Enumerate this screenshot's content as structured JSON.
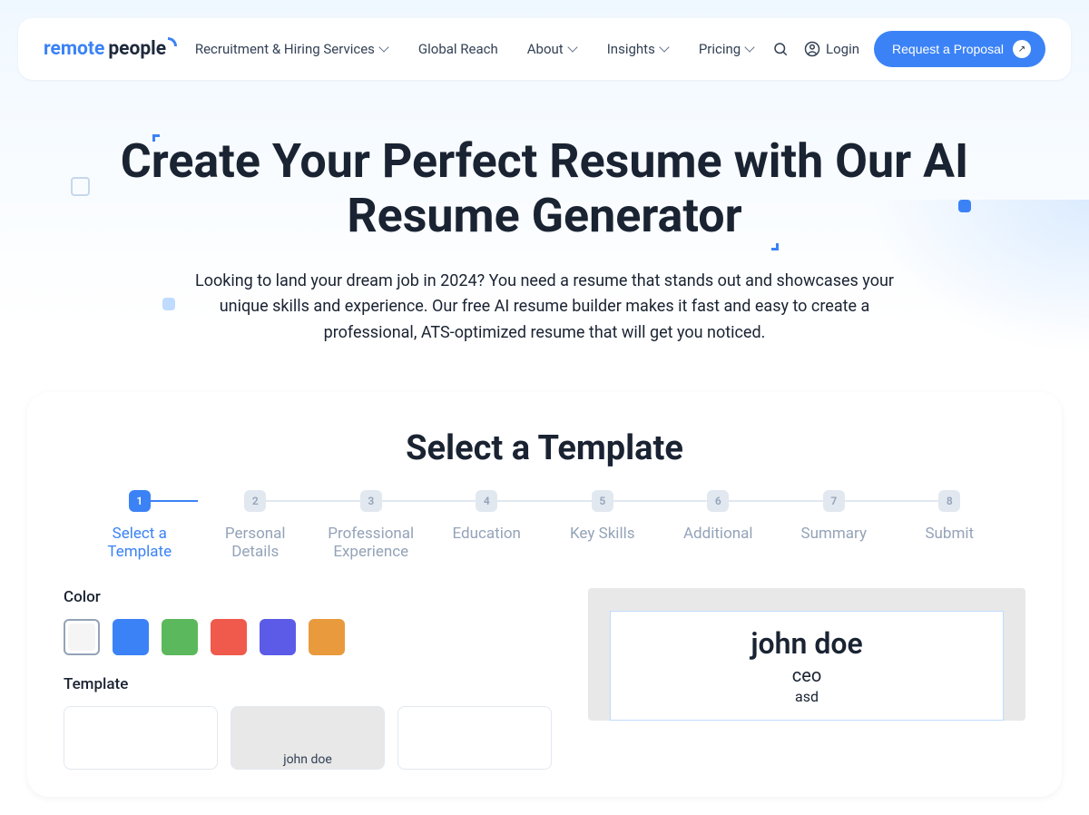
{
  "header": {
    "logo_remote": "remote",
    "logo_people": "people",
    "nav": {
      "recruitment": "Recruitment & Hiring Services",
      "global_reach": "Global Reach",
      "about": "About",
      "insights": "Insights",
      "pricing": "Pricing"
    },
    "login": "Login",
    "cta": "Request a Proposal"
  },
  "hero": {
    "title": "Create Your Perfect Resume with Our AI Resume Generator",
    "subtitle": "Looking to land your dream job in 2024? You need a resume that stands out and showcases your unique skills and experience. Our free AI resume builder makes it fast and easy to create a professional, ATS-optimized resume that will get you noticed."
  },
  "card": {
    "title": "Select a Template",
    "steps": [
      {
        "num": "1",
        "label": "Select a Template"
      },
      {
        "num": "2",
        "label": "Personal Details"
      },
      {
        "num": "3",
        "label": "Professional Experience"
      },
      {
        "num": "4",
        "label": "Education"
      },
      {
        "num": "5",
        "label": "Key Skills"
      },
      {
        "num": "6",
        "label": "Additional"
      },
      {
        "num": "7",
        "label": "Summary"
      },
      {
        "num": "8",
        "label": "Submit"
      }
    ],
    "color_label": "Color",
    "template_label": "Template",
    "colors": [
      "#f5f5f5",
      "#3b82f6",
      "#5cb85c",
      "#ef5a4c",
      "#5b5be8",
      "#e89a3c"
    ],
    "template2_text": "john doe",
    "preview": {
      "name": "john doe",
      "title": "ceo",
      "sub": "asd"
    }
  }
}
